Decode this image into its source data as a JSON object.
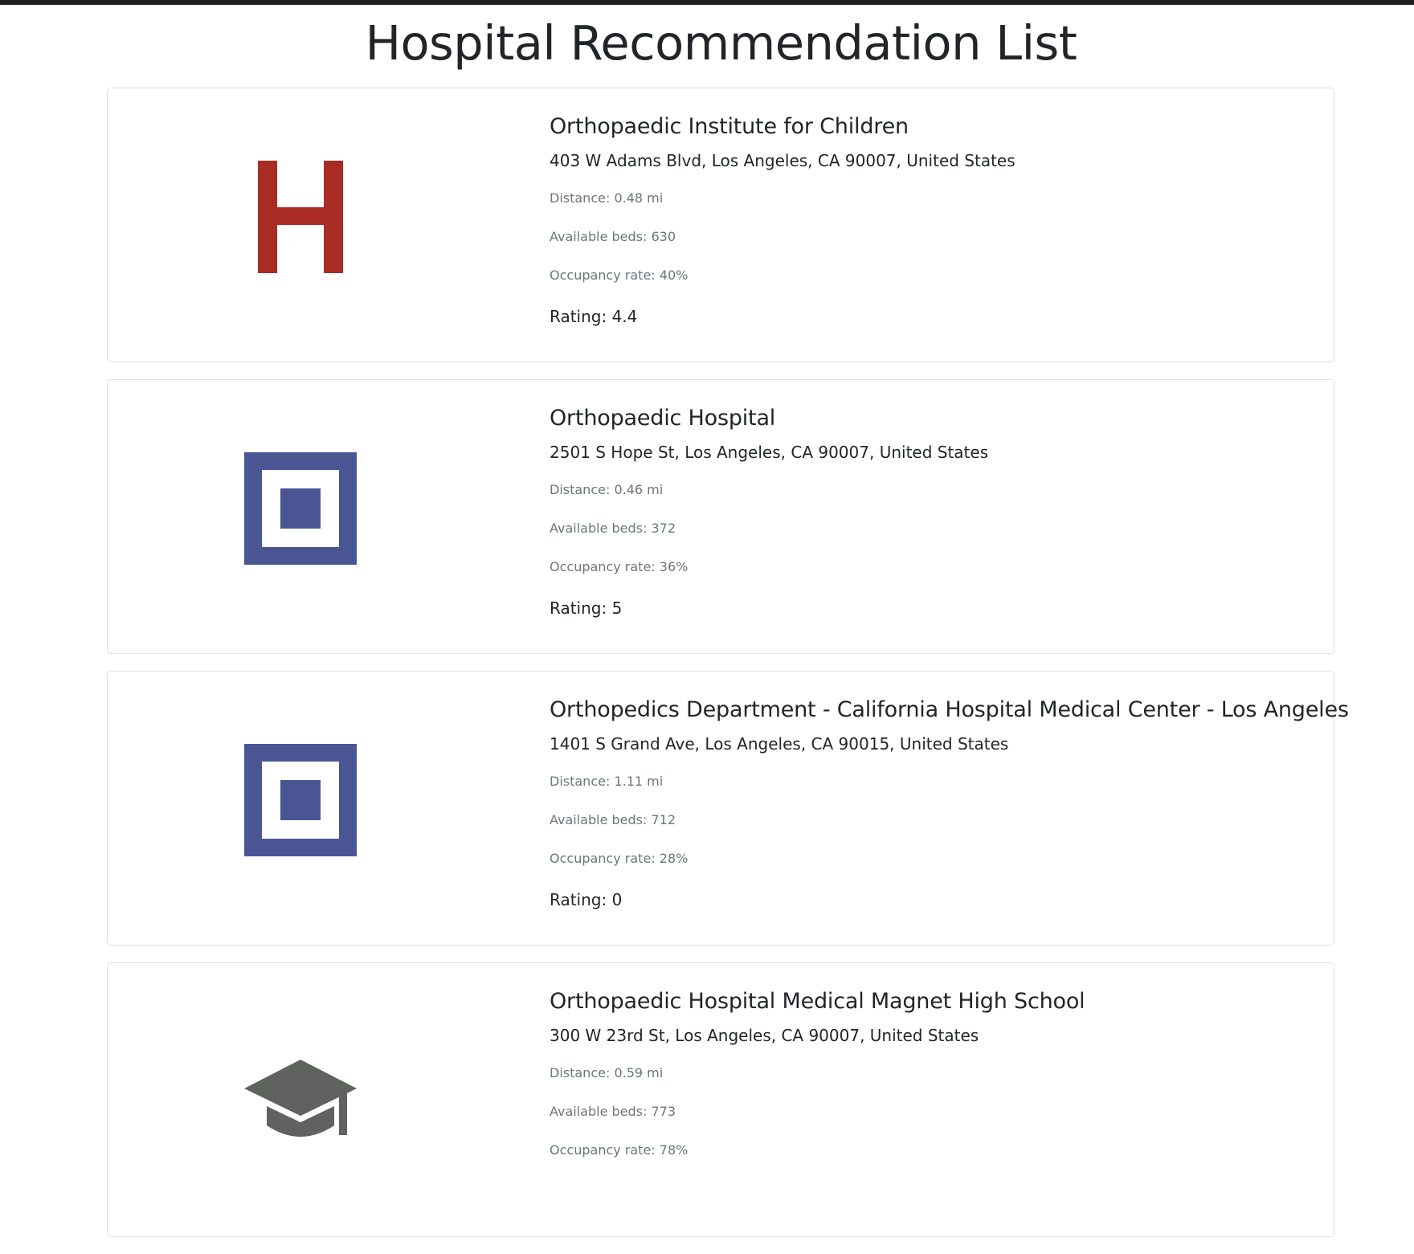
{
  "page": {
    "title": "Hospital Recommendation List"
  },
  "colors": {
    "hospital_icon_red": "#a82c24",
    "building_icon_blue": "#4a5694",
    "school_icon_gray": "#5f625f",
    "muted_text": "#6c757d"
  },
  "hospitals": [
    {
      "icon": "hospital-h-icon",
      "name": "Orthopaedic Institute for Children",
      "address": "403 W Adams Blvd, Los Angeles, CA 90007, United States",
      "distance": "Distance: 0.48 mi",
      "beds": "Available beds: 630",
      "occupancy": "Occupancy rate: 40%",
      "rating": "Rating: 4.4"
    },
    {
      "icon": "building-icon",
      "name": "Orthopaedic Hospital",
      "address": "2501 S Hope St, Los Angeles, CA 90007, United States",
      "distance": "Distance: 0.46 mi",
      "beds": "Available beds: 372",
      "occupancy": "Occupancy rate: 36%",
      "rating": "Rating: 5"
    },
    {
      "icon": "building-icon",
      "name": "Orthopedics Department - California Hospital Medical Center - Los Angeles",
      "address": "1401 S Grand Ave, Los Angeles, CA 90015, United States",
      "distance": "Distance: 1.11 mi",
      "beds": "Available beds: 712",
      "occupancy": "Occupancy rate: 28%",
      "rating": "Rating: 0"
    },
    {
      "icon": "graduation-cap-icon",
      "name": "Orthopaedic Hospital Medical Magnet High School",
      "address": "300 W 23rd St, Los Angeles, CA 90007, United States",
      "distance": "Distance: 0.59 mi",
      "beds": "Available beds: 773",
      "occupancy": "Occupancy rate: 78%",
      "rating": ""
    }
  ]
}
